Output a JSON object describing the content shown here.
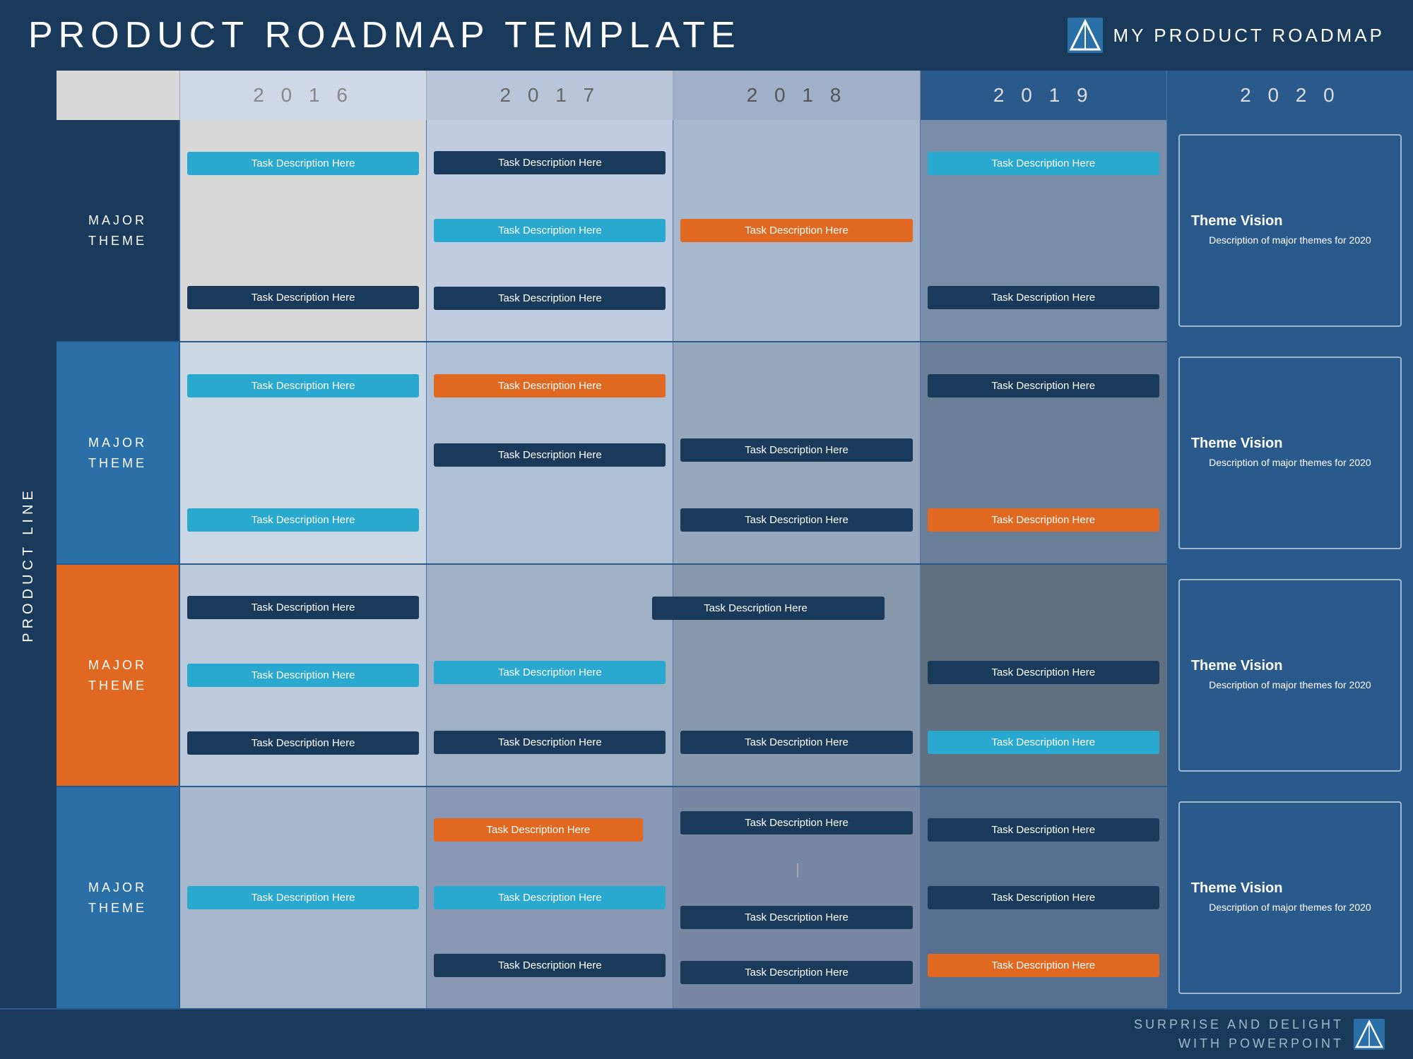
{
  "header": {
    "title": "PRODUCT  ROADMAP  TEMPLATE",
    "brand": "MY PRODUCT ROADMAP"
  },
  "years": [
    "2 0 1 6",
    "2 0 1 7",
    "2 0 1 8",
    "2 0 1 9",
    "2 0 2 0"
  ],
  "vertical_label": "PRODUCT LINE",
  "rows": [
    {
      "theme_label": "MAJOR\nTHEME",
      "theme_color": "dark-blue",
      "cells": {
        "2016": [
          {
            "text": "Task Description Here",
            "style": "cyan"
          },
          {
            "text": "",
            "style": ""
          },
          {
            "text": "Task Description Here",
            "style": "dark-navy"
          }
        ],
        "2017": [
          {
            "text": "Task Description Here",
            "style": "dark-navy"
          },
          {
            "text": "Task Description Here",
            "style": "cyan"
          },
          {
            "text": "Task Description Here",
            "style": "dark-navy"
          }
        ],
        "2018": [
          {
            "text": "",
            "style": ""
          },
          {
            "text": "Task Description Here",
            "style": "orange"
          },
          {
            "text": "",
            "style": ""
          }
        ],
        "2019": [
          {
            "text": "Task Description Here",
            "style": "cyan"
          },
          {
            "text": "",
            "style": ""
          },
          {
            "text": "Task Description Here",
            "style": "dark-navy"
          }
        ],
        "2020": {
          "title": "Theme Vision",
          "desc": "Description of major themes for 2020"
        }
      }
    },
    {
      "theme_label": "MAJOR\nTHEME",
      "theme_color": "mid-blue",
      "cells": {
        "2016": [
          {
            "text": "Task Description Here",
            "style": "cyan"
          },
          {
            "text": "",
            "style": ""
          },
          {
            "text": "Task Description Here",
            "style": "cyan"
          }
        ],
        "2017": [
          {
            "text": "Task Description Here",
            "style": "orange"
          },
          {
            "text": "Task Description Here",
            "style": "dark-navy"
          },
          {
            "text": "",
            "style": ""
          }
        ],
        "2018": [
          {
            "text": "",
            "style": ""
          },
          {
            "text": "Task Description Here",
            "style": "dark-navy"
          },
          {
            "text": "Task Description Here",
            "style": "dark-navy"
          }
        ],
        "2019": [
          {
            "text": "Task Description Here",
            "style": "dark-navy"
          },
          {
            "text": "",
            "style": ""
          },
          {
            "text": "Task Description Here",
            "style": "orange"
          }
        ],
        "2020": {
          "title": "Theme Vision",
          "desc": "Description of major themes for 2020"
        }
      }
    },
    {
      "theme_label": "MAJOR\nTHEME",
      "theme_color": "orange",
      "cells": {
        "2016": [
          {
            "text": "Task Description Here",
            "style": "dark-navy"
          },
          {
            "text": "Task Description Here",
            "style": "cyan"
          },
          {
            "text": "Task Description Here",
            "style": "dark-navy"
          }
        ],
        "2017": [
          {
            "text": "",
            "style": ""
          },
          {
            "text": "Task Description Here",
            "style": "cyan"
          },
          {
            "text": "Task Description Here",
            "style": "dark-navy"
          }
        ],
        "2018": [
          {
            "text": "Task Description Here",
            "style": "dark-navy"
          },
          {
            "text": "",
            "style": ""
          },
          {
            "text": "Task Description Here",
            "style": "dark-navy"
          }
        ],
        "2019": [
          {
            "text": "",
            "style": ""
          },
          {
            "text": "Task Description Here",
            "style": "dark-navy"
          },
          {
            "text": "Task Description Here",
            "style": "cyan"
          }
        ],
        "2020": {
          "title": "Theme Vision",
          "desc": "Description of major themes for 2020"
        }
      }
    },
    {
      "theme_label": "MAJOR\nTHEME",
      "theme_color": "mid-blue",
      "cells": {
        "2016": [
          {
            "text": "",
            "style": ""
          },
          {
            "text": "Task Description Here",
            "style": "cyan"
          },
          {
            "text": "",
            "style": ""
          }
        ],
        "2017": [
          {
            "text": "Task Description Here",
            "style": "orange"
          },
          {
            "text": "Task Description Here",
            "style": "cyan"
          },
          {
            "text": "Task Description Here",
            "style": "dark-navy"
          }
        ],
        "2018": [
          {
            "text": "Task Description Here",
            "style": "dark-navy"
          },
          {
            "text": "",
            "style": ""
          },
          {
            "text": "Task Description Here",
            "style": "dark-navy"
          }
        ],
        "2019": [
          {
            "text": "Task Description Here",
            "style": "dark-navy"
          },
          {
            "text": "Task Description Here",
            "style": "dark-navy"
          },
          {
            "text": "Task Description Here",
            "style": "orange"
          }
        ],
        "2020": {
          "title": "Theme Vision",
          "desc": "Description of major themes for 2020"
        }
      }
    }
  ],
  "footer": {
    "line1": "SURPRISE AND DELIGHT",
    "line2": "WITH POWERPOINT"
  },
  "task_label": "Task Description Here"
}
